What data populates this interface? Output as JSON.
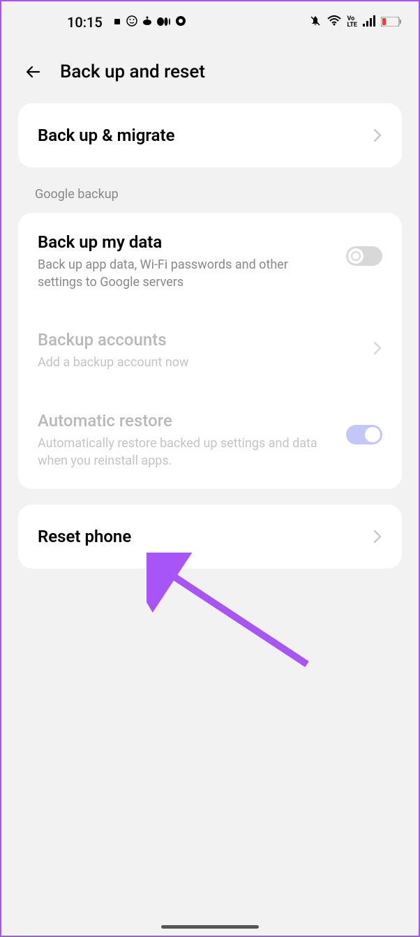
{
  "statusBar": {
    "time": "10:15"
  },
  "header": {
    "title": "Back up and reset"
  },
  "migrateCard": {
    "title": "Back up & migrate"
  },
  "googleSection": {
    "header": "Google backup",
    "backupData": {
      "title": "Back up my data",
      "subtitle": "Back up app data, Wi-Fi passwords and other settings to Google servers"
    },
    "backupAccounts": {
      "title": "Backup accounts",
      "subtitle": "Add a backup account now"
    },
    "autoRestore": {
      "title": "Automatic restore",
      "subtitle": "Automatically restore backed up settings and data when you reinstall apps."
    }
  },
  "resetCard": {
    "title": "Reset phone"
  }
}
